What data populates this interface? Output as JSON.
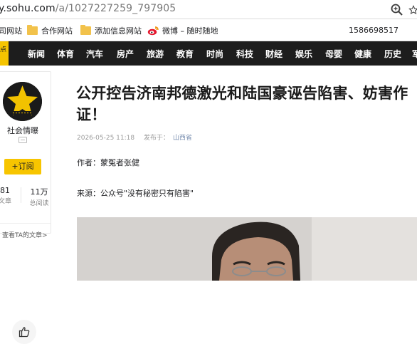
{
  "address_bar": {
    "host": "y.sohu.com",
    "path": "/a/1027227259_797905"
  },
  "bookmarks": {
    "items": [
      {
        "label": "司网站",
        "icon": "none"
      },
      {
        "label": "合作网站",
        "icon": "folder-icon"
      },
      {
        "label": "添加信息网站",
        "icon": "folder-icon"
      },
      {
        "label": "微博 – 随时随地",
        "icon": "weibo-icon"
      }
    ],
    "phone": "1586698517"
  },
  "nav": {
    "logo_fragment": "点",
    "items": [
      "新闻",
      "体育",
      "汽车",
      "房产",
      "旅游",
      "教育",
      "时尚",
      "科技",
      "财经",
      "娱乐",
      "母婴",
      "健康",
      "历史",
      "军"
    ]
  },
  "author": {
    "name": "社会情曝",
    "subscribe_label": "+订阅",
    "stats": [
      {
        "value": "81",
        "label": "文章"
      },
      {
        "value": "11万",
        "label": "总阅读"
      }
    ],
    "view_all": "查看TA的文章>"
  },
  "article": {
    "title": "公开控告济南邦德激光和陆国豪诬告陷害、妨害作证！",
    "date": "2026-05-25 11:18",
    "source_label": "发布于：",
    "source": "山西省",
    "author_line": "作者：蒙冤者张健",
    "source_line": "来源：公众号\"没有秘密只有陷害\""
  },
  "colors": {
    "nav_bg": "#1d1d1d",
    "accent_yellow": "#f7c500"
  }
}
